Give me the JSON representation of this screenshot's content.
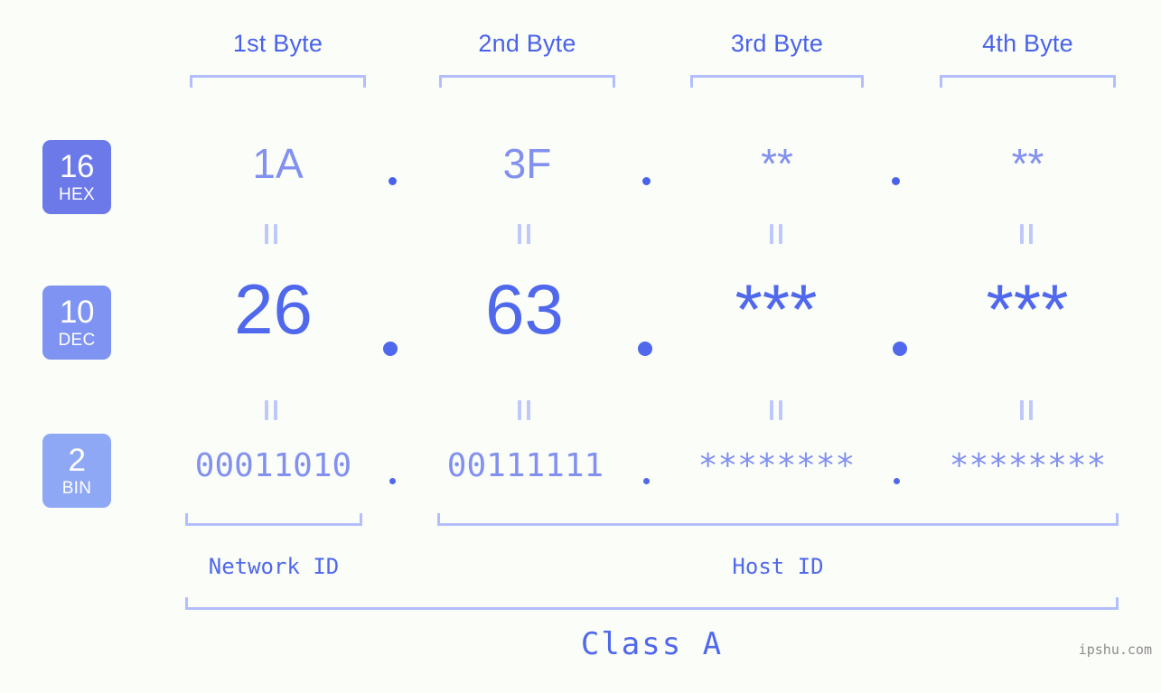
{
  "background_color": "#fbfdf8",
  "colors": {
    "header_label": "#4a62ea",
    "bracket": "#b3beff",
    "hex_row": "#8290f0",
    "dec_row": "#5068ec",
    "bin_row": "#8290f0",
    "badge_hex": "#6c79e8",
    "badge_dec": "#7f94f2",
    "badge_bin": "#8fa8f5",
    "equals": "#bfc8fb",
    "watermark": "#8c8c8c"
  },
  "header": {
    "bytes": [
      {
        "label": "1st Byte"
      },
      {
        "label": "2nd Byte"
      },
      {
        "label": "3rd Byte"
      },
      {
        "label": "4th Byte"
      }
    ]
  },
  "badges": [
    {
      "number": "16",
      "name": "HEX"
    },
    {
      "number": "10",
      "name": "DEC"
    },
    {
      "number": "2",
      "name": "BIN"
    }
  ],
  "rows": {
    "hex": {
      "values": [
        "1A",
        "3F",
        "**",
        "**"
      ],
      "separator": "."
    },
    "dec": {
      "values": [
        "26",
        "63",
        "***",
        "***"
      ],
      "separator": "."
    },
    "bin": {
      "values": [
        "00011010",
        "00111111",
        "********",
        "********"
      ],
      "separator": "."
    }
  },
  "equals_symbol": "=",
  "footer": {
    "network_id_label": "Network ID",
    "host_id_label": "Host ID",
    "class_label": "Class A"
  },
  "watermark": "ipshu.com"
}
